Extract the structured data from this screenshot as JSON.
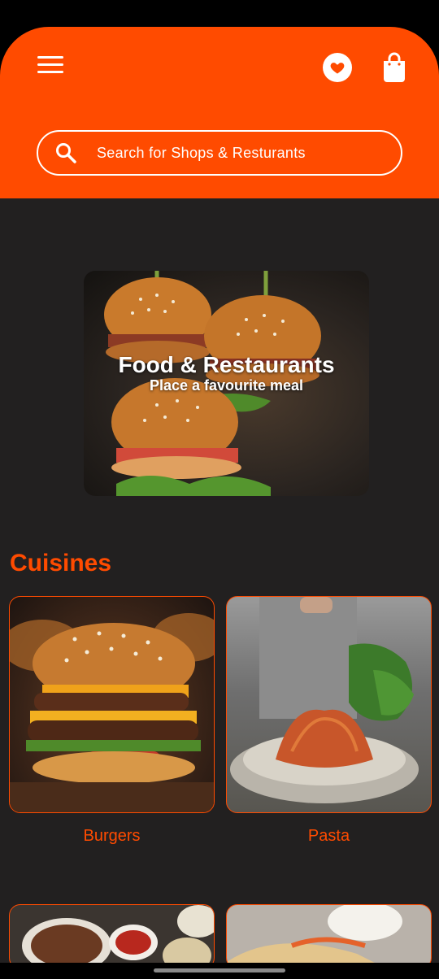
{
  "header": {
    "search": {
      "placeholder": "Search for Shops & Resturants"
    },
    "icons": {
      "menu": "hamburger-menu-icon",
      "favorites": "heart-icon",
      "cart": "shopping-bag-icon",
      "search": "magnifier-icon"
    }
  },
  "banner": {
    "title": "Food & Restaurants",
    "subtitle": "Place a favourite meal"
  },
  "cuisines": {
    "title": "Cuisines",
    "items": [
      {
        "label": "Burgers"
      },
      {
        "label": "Pasta"
      }
    ]
  },
  "colors": {
    "accent": "#ff4b00",
    "background": "#222020",
    "text_on_accent": "#ffffff"
  }
}
